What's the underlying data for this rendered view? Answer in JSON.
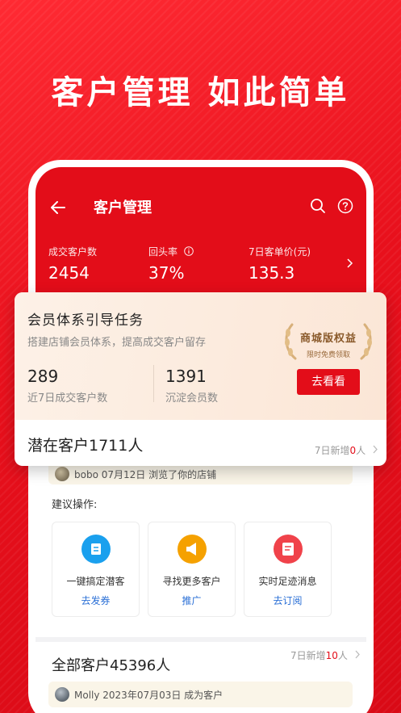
{
  "headline": "客户管理 如此简单",
  "header": {
    "title": "客户管理",
    "stats": [
      {
        "label": "成交客户数",
        "value": "2454"
      },
      {
        "label": "回头率",
        "value": "37%"
      },
      {
        "label": "7日客单价(元)",
        "value": "135.3"
      }
    ]
  },
  "task": {
    "title": "会员体系引导任务",
    "desc": "搭建店铺会员体系，提高成交客户留存",
    "metrics": [
      {
        "num": "289",
        "caption": "近7日成交客户数"
      },
      {
        "num": "1391",
        "caption": "沉淀会员数"
      }
    ],
    "badge_main": "商城版权益",
    "badge_sub": "限时免费领取",
    "cta": "去看看"
  },
  "potential": {
    "title": "潜在客户1711人",
    "new_prefix": "7日新增",
    "new_count": "0",
    "new_suffix": "人"
  },
  "activity": "bobo 07月12日 浏览了你的店铺",
  "suggest_label": "建议操作:",
  "cards": [
    {
      "title": "一键搞定潜客",
      "action": "去发券",
      "icon": "coupon-icon",
      "color": "#1aa0ee"
    },
    {
      "title": "寻找更多客户",
      "action": "推广",
      "icon": "megaphone-icon",
      "color": "#f5a100"
    },
    {
      "title": "实时足迹消息",
      "action": "去订阅",
      "icon": "message-icon",
      "color": "#f0424a"
    }
  ],
  "all_customers": {
    "title": "全部客户45396人",
    "new_prefix": "7日新增",
    "new_count": "10",
    "new_suffix": "人"
  },
  "member_activity": "Molly 2023年07月03日 成为客户",
  "colors": {
    "brand": "#e30d19",
    "link": "#2a6fd6"
  }
}
